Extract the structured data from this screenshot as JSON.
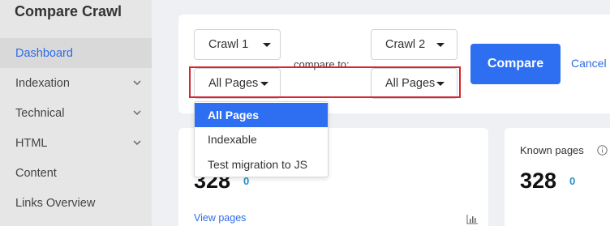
{
  "app": {
    "title": "Compare Crawl"
  },
  "sidebar": {
    "items": [
      {
        "label": "Dashboard",
        "active": true,
        "expandable": false
      },
      {
        "label": "Indexation",
        "active": false,
        "expandable": true
      },
      {
        "label": "Technical",
        "active": false,
        "expandable": true
      },
      {
        "label": "HTML",
        "active": false,
        "expandable": true
      },
      {
        "label": "Content",
        "active": false,
        "expandable": false
      },
      {
        "label": "Links Overview",
        "active": false,
        "expandable": false
      }
    ]
  },
  "compare_form": {
    "crawl_1": "Crawl 1",
    "crawl_2": "Crawl 2",
    "segment_1": "All Pages",
    "segment_2": "All Pages",
    "compare_to_label": "compare to:",
    "compare_button": "Compare",
    "cancel_button": "Cancel"
  },
  "segment_dropdown": {
    "options": [
      "All Pages",
      "Indexable",
      "Test migration to JS"
    ],
    "selected": "All Pages"
  },
  "stats": {
    "left_card": {
      "value": "328",
      "delta": "0",
      "link": "View pages"
    },
    "right_card": {
      "label": "Known pages",
      "value": "328",
      "delta": "0"
    }
  },
  "colors": {
    "accent": "#2e6ff2",
    "highlight_border": "#d7262d",
    "delta": "#2a8fc4"
  }
}
